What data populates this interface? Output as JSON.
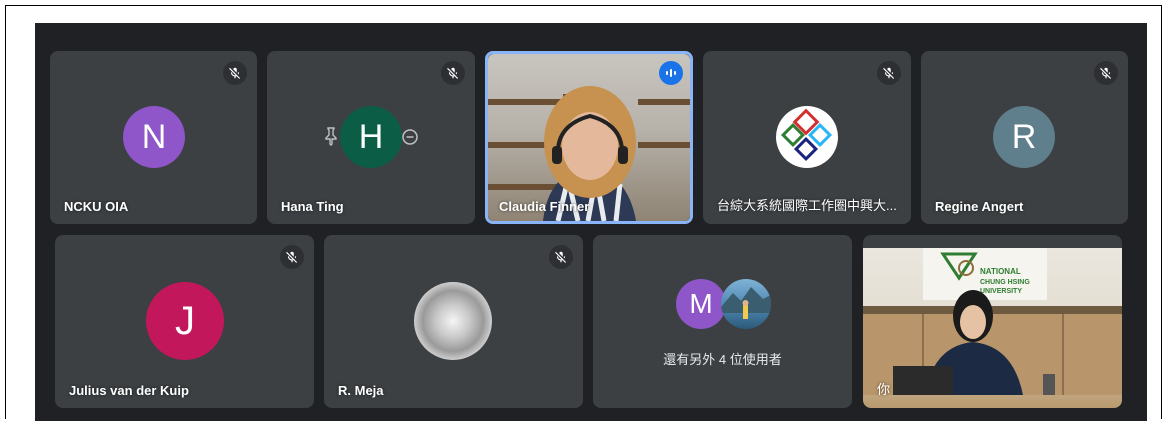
{
  "colors": {
    "stage": "#202124",
    "tile": "#3c4043",
    "active_border": "#8ab4f8",
    "speaking": "#1a73e8"
  },
  "participants": [
    {
      "name": "NCKU OIA",
      "initial": "N",
      "avatar_color": "#8e56c8",
      "muted": true
    },
    {
      "name": "Hana Ting",
      "initial": "H",
      "avatar_color": "#0b5e45",
      "muted": true
    },
    {
      "name": "Claudia Finner",
      "video": true,
      "speaking": true
    },
    {
      "name": "台綜大系統國際工作圈中興大...",
      "logo": true,
      "muted": true
    },
    {
      "name": "Regine Angert",
      "initial": "R",
      "avatar_color": "#5f7f8c",
      "muted": true
    },
    {
      "name": "Julius van der Kuip",
      "initial": "J",
      "avatar_color": "#c2185b",
      "muted": true
    },
    {
      "name": "R. Meja",
      "muted": true
    },
    {
      "initial": "M",
      "avatar_color": "#8e56c8",
      "caption": "還有另外 4 位使用者"
    },
    {
      "name": "你",
      "video": true,
      "banner": "NATIONAL CHUNG HSING UNIVERSITY"
    }
  ],
  "icons": {
    "mic_off": "mic-off-icon",
    "speaking": "audio-level-icon",
    "pin": "pin-icon",
    "remove": "remove-icon"
  }
}
